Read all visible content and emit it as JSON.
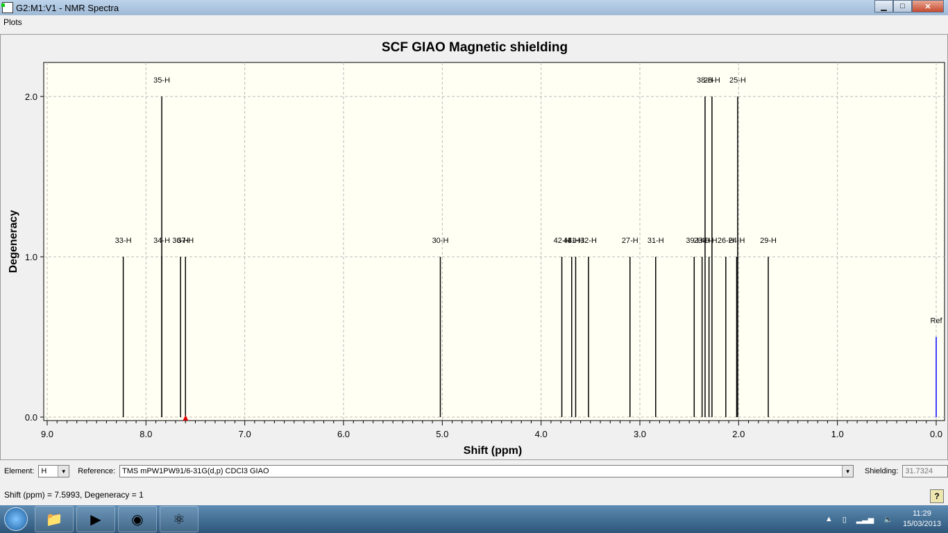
{
  "window": {
    "title": "G2:M1:V1 - NMR Spectra",
    "min": "▁",
    "max": "□",
    "close": "✕"
  },
  "menu": {
    "plots": "Plots"
  },
  "chart_data": {
    "type": "bar",
    "title": "SCF GIAO Magnetic shielding",
    "xlabel": "Shift (ppm)",
    "ylabel": "Degeneracy",
    "xlim": [
      9.0,
      0.0
    ],
    "ylim": [
      0,
      2.2
    ],
    "xticks": [
      "9.0",
      "8.0",
      "7.0",
      "6.0",
      "5.0",
      "4.0",
      "3.0",
      "2.0",
      "1.0",
      "0.0"
    ],
    "yticks": [
      "0.0",
      "1.0",
      "2.0"
    ],
    "grid": true,
    "peaks": [
      {
        "label": "33-H",
        "shift": 8.23,
        "deg": 1
      },
      {
        "label": "35-H",
        "shift": 7.84,
        "deg": 2
      },
      {
        "label": "34-H",
        "shift": 7.84,
        "deg": 1
      },
      {
        "label": "36-H",
        "shift": 7.65,
        "deg": 1
      },
      {
        "label": "37-H",
        "shift": 7.6,
        "deg": 1
      },
      {
        "label": "30-H",
        "shift": 5.02,
        "deg": 1
      },
      {
        "label": "42-H",
        "shift": 3.79,
        "deg": 1
      },
      {
        "label": "43-H",
        "shift": 3.69,
        "deg": 1
      },
      {
        "label": "41-H",
        "shift": 3.65,
        "deg": 1
      },
      {
        "label": "32-H",
        "shift": 3.52,
        "deg": 1
      },
      {
        "label": "27-H",
        "shift": 3.1,
        "deg": 1
      },
      {
        "label": "31-H",
        "shift": 2.84,
        "deg": 1
      },
      {
        "label": "39-H",
        "shift": 2.45,
        "deg": 1
      },
      {
        "label": "23-H",
        "shift": 2.37,
        "deg": 1
      },
      {
        "label": "38-H",
        "shift": 2.34,
        "deg": 2
      },
      {
        "label": "28-H",
        "shift": 2.27,
        "deg": 2
      },
      {
        "label": "40-H",
        "shift": 2.3,
        "deg": 1
      },
      {
        "label": "26-H",
        "shift": 2.13,
        "deg": 1
      },
      {
        "label": "24-H",
        "shift": 2.02,
        "deg": 1
      },
      {
        "label": "25-H",
        "shift": 2.01,
        "deg": 2
      },
      {
        "label": "29-H",
        "shift": 1.7,
        "deg": 1
      },
      {
        "label": "Ref",
        "shift": 0.0,
        "deg": 0.5,
        "color": "#0000ff"
      }
    ],
    "marker": {
      "shift": 7.5993,
      "color": "#e00000"
    }
  },
  "controls": {
    "element_label": "Element:",
    "element_value": "H",
    "reference_label": "Reference:",
    "reference_value": "TMS mPW1PW91/6-31G(d,p) CDCl3 GIAO",
    "shielding_label": "Shielding:",
    "shielding_value": "31.7324"
  },
  "status": "Shift (ppm) = 7.5993, Degeneracy = 1",
  "help": "?",
  "tray": {
    "time": "11:29",
    "date": "15/03/2013"
  }
}
